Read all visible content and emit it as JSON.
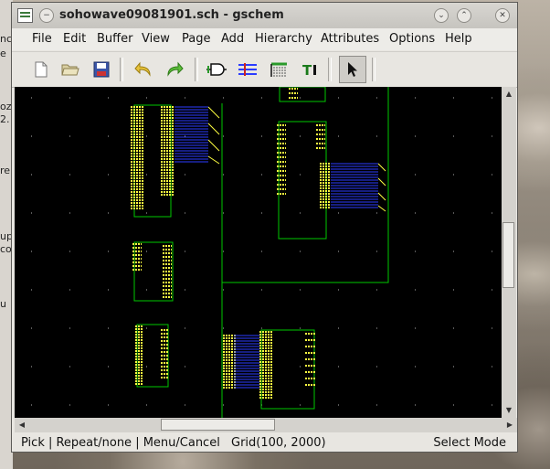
{
  "window": {
    "title": "sohowave09081901.sch - gschem"
  },
  "menubar": {
    "items": [
      "File",
      "Edit",
      "Buffer",
      "View",
      "Page",
      "Add",
      "Hierarchy",
      "Attributes",
      "Options",
      "Help"
    ]
  },
  "toolbar": {
    "buttons": [
      "new-file",
      "open-file",
      "save-file",
      "undo",
      "redo",
      "add-component",
      "add-net",
      "add-bus",
      "add-text",
      "select"
    ]
  },
  "statusbar": {
    "left": "Pick | Repeat/none | Menu/Cancel",
    "grid": "Grid(100, 2000)",
    "mode": "Select Mode"
  },
  "left_strip": {
    "fragments": [
      "nc",
      "e",
      "oz",
      "2.",
      "re",
      "up",
      "co",
      "u"
    ]
  },
  "colors": {
    "canvas": "#000000",
    "component_outline": "#00c800",
    "pin_label": "#ffff40",
    "net": "#00c800",
    "bus": "#2b3cff"
  }
}
